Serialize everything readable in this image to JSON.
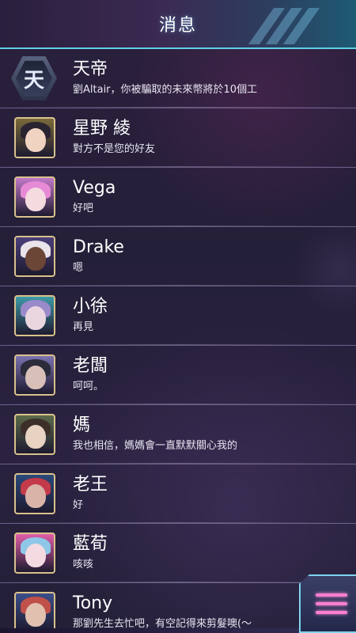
{
  "header": {
    "title": "消息"
  },
  "conversations": [
    {
      "name": "天帝",
      "message": "劉Altair，你被騙取的未來幣將於10個工",
      "avatar_icon": "tiandi-emblem-icon",
      "emblem_char": "天"
    },
    {
      "name": "星野 綾",
      "message": "對方不是您的好友",
      "avatar_icon": "avatar-hoshino-aya",
      "hair": "#2a2430",
      "skin": "#f1d3c2",
      "bg": "#7a6a3a"
    },
    {
      "name": "Vega",
      "message": "好吧",
      "avatar_icon": "avatar-vega",
      "hair": "#e78ad6",
      "skin": "#f3dbe0",
      "bg": "#c07ac8"
    },
    {
      "name": "Drake",
      "message": "嗯",
      "avatar_icon": "avatar-drake",
      "hair": "#e9e3ea",
      "skin": "#6b4636",
      "bg": "#4a3f7a"
    },
    {
      "name": "小徐",
      "message": "再見",
      "avatar_icon": "avatar-xiao-xu",
      "hair": "#9a8ac9",
      "skin": "#e9d6df",
      "bg": "#3f9aa8"
    },
    {
      "name": "老闆",
      "message": "呵呵。",
      "avatar_icon": "avatar-boss",
      "hair": "#2b2b3a",
      "skin": "#d8c0b8",
      "bg": "#7b72b0"
    },
    {
      "name": "媽",
      "message": "我也相信，媽媽會一直默默關心我的",
      "avatar_icon": "avatar-mom",
      "hair": "#3c2f2a",
      "skin": "#e8d2c2",
      "bg": "#5c6b4a"
    },
    {
      "name": "老王",
      "message": "好",
      "avatar_icon": "avatar-lao-wang",
      "hair": "#c43a4a",
      "skin": "#d9b3a8",
      "bg": "#2a4a7a"
    },
    {
      "name": "藍荀",
      "message": "咳咳",
      "avatar_icon": "avatar-lan-xun",
      "hair": "#8fc7e8",
      "skin": "#f4dbe2",
      "bg": "#e05fa8"
    },
    {
      "name": "Tony",
      "message": "那劉先生去忙吧，有空記得來剪髮噢(～",
      "avatar_icon": "avatar-tony",
      "hair": "#c0504a",
      "skin": "#e1c0b0",
      "bg": "#3a4e8a"
    }
  ],
  "menu_button": {
    "icon": "menu-icon",
    "accent": "#ff7fd0"
  },
  "colors": {
    "header_border": "#5fd0e6",
    "avatar_frame": "#d9c18c"
  }
}
